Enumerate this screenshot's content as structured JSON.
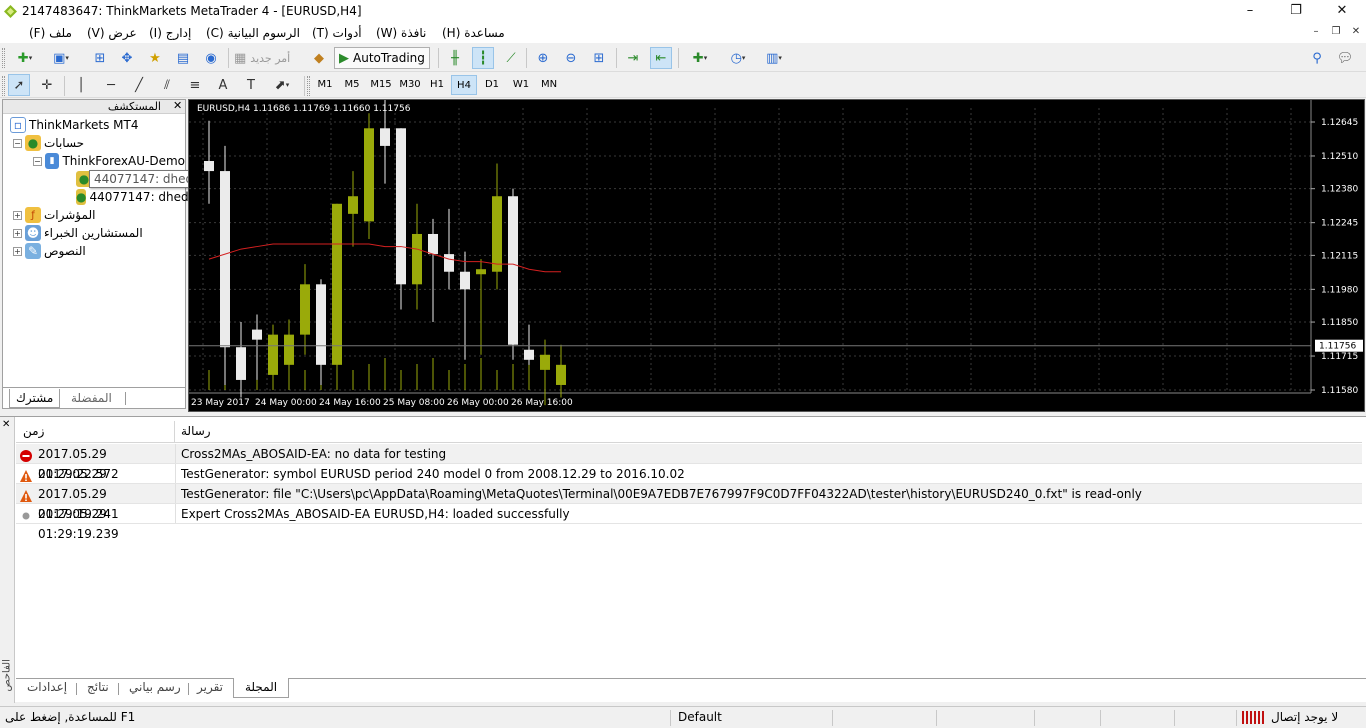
{
  "window": {
    "title": "2147483647: ThinkMarkets MetaTrader 4 - [EURUSD,H4]",
    "controls": [
      "–",
      "❐",
      "✕"
    ]
  },
  "menu": {
    "items": [
      "(F) ملف",
      "(V) عرض",
      "(I) إدارج",
      "(C) الرسوم البيانية",
      "(T) أدوات",
      "(W) نافذة",
      "(H) مساعدة"
    ]
  },
  "toolbar": {
    "new_order_label": "أمر جديد",
    "autotrading_label": "AutoTrading"
  },
  "timeframes": [
    "M1",
    "M5",
    "M15",
    "M30",
    "H1",
    "H4",
    "D1",
    "W1",
    "MN"
  ],
  "timeframe_active": "H4",
  "navigator": {
    "title": "المستكشف",
    "root": "ThinkMarkets MT4",
    "accounts": "حسابات",
    "server": "ThinkForexAU-Demo",
    "account1": "44077147: dhedhDFedhe",
    "account2": "44077147: dhedh",
    "indicators": "المؤشرات",
    "experts": "المستشارين الخبراء",
    "scripts": "النصوص",
    "tab_common": "مشترك",
    "tab_favorites": "المفضلة"
  },
  "chart_data": {
    "type": "candlestick",
    "symbol_info": "EURUSD,H4  1.11686 1.11769 1.11660 1.11756",
    "current_price": "1.11756",
    "y_ticks": [
      "1.12645",
      "1.12510",
      "1.12380",
      "1.12245",
      "1.12115",
      "1.11980",
      "1.11850",
      "1.11715",
      "1.11580"
    ],
    "y_tick_values": [
      1.12645,
      1.1251,
      1.1238,
      1.12245,
      1.12115,
      1.1198,
      1.1185,
      1.11715,
      1.1158
    ],
    "x_ticks": [
      "23 May 2017",
      "24 May 00:00",
      "24 May 16:00",
      "25 May 08:00",
      "26 May 00:00",
      "26 May 16:00"
    ],
    "candles": [
      {
        "o": 1.1249,
        "h": 1.1265,
        "l": 1.1232,
        "c": 1.1245
      },
      {
        "o": 1.1245,
        "h": 1.1255,
        "l": 1.116,
        "c": 1.1175
      },
      {
        "o": 1.1175,
        "h": 1.1185,
        "l": 1.1155,
        "c": 1.1162
      },
      {
        "o": 1.1182,
        "h": 1.1188,
        "l": 1.1162,
        "c": 1.1178
      },
      {
        "o": 1.1164,
        "h": 1.1184,
        "l": 1.1164,
        "c": 1.118
      },
      {
        "o": 1.1168,
        "h": 1.1186,
        "l": 1.1162,
        "c": 1.118
      },
      {
        "o": 1.118,
        "h": 1.1208,
        "l": 1.1172,
        "c": 1.12
      },
      {
        "o": 1.12,
        "h": 1.1202,
        "l": 1.116,
        "c": 1.1168
      },
      {
        "o": 1.1168,
        "h": 1.1232,
        "l": 1.1162,
        "c": 1.1232
      },
      {
        "o": 1.1228,
        "h": 1.1245,
        "l": 1.1215,
        "c": 1.1235
      },
      {
        "o": 1.1225,
        "h": 1.1268,
        "l": 1.1218,
        "c": 1.1262
      },
      {
        "o": 1.1262,
        "h": 1.1275,
        "l": 1.124,
        "c": 1.1255
      },
      {
        "o": 1.1262,
        "h": 1.1262,
        "l": 1.119,
        "c": 1.12
      },
      {
        "o": 1.12,
        "h": 1.1232,
        "l": 1.119,
        "c": 1.122
      },
      {
        "o": 1.122,
        "h": 1.1226,
        "l": 1.1185,
        "c": 1.1212
      },
      {
        "o": 1.1212,
        "h": 1.123,
        "l": 1.1198,
        "c": 1.1205
      },
      {
        "o": 1.1205,
        "h": 1.1213,
        "l": 1.117,
        "c": 1.1198
      },
      {
        "o": 1.1204,
        "h": 1.121,
        "l": 1.1172,
        "c": 1.1206
      },
      {
        "o": 1.1205,
        "h": 1.1248,
        "l": 1.1198,
        "c": 1.1235
      },
      {
        "o": 1.1235,
        "h": 1.1238,
        "l": 1.117,
        "c": 1.1176
      },
      {
        "o": 1.1174,
        "h": 1.1184,
        "l": 1.1168,
        "c": 1.117
      },
      {
        "o": 1.1166,
        "h": 1.1178,
        "l": 1.1152,
        "c": 1.1172
      },
      {
        "o": 1.116,
        "h": 1.1176,
        "l": 1.1155,
        "c": 1.1168
      }
    ],
    "ma": [
      1.121,
      1.1212,
      1.1214,
      1.1215,
      1.1216,
      1.1216,
      1.1216,
      1.1216,
      1.1216,
      1.1216,
      1.1216,
      1.1215,
      1.1215,
      1.1214,
      1.1212,
      1.121,
      1.1209,
      1.1209,
      1.1208,
      1.1208,
      1.1206,
      1.1205,
      1.1205
    ],
    "colors": {
      "bull": "#9aaa0a",
      "bear": "#ebebeb",
      "ma": "#d42020",
      "grid": "#3a3a3a",
      "axis": "#ffffff"
    }
  },
  "terminal": {
    "side_label": "الفاحص",
    "col_time": "زمن",
    "col_message": "رسالة",
    "rows": [
      {
        "icon": "error-icon",
        "time": "2017.05.29 01:29:22.572",
        "message": "Cross2MAs_ABOSAID-EA: no data for testing"
      },
      {
        "icon": "warning-icon",
        "time": "2017.05.29 01:29:19.241",
        "message": "TestGenerator: symbol EURUSD period 240 model 0 from 2008.12.29 to 2016.10.02"
      },
      {
        "icon": "warning-icon",
        "time": "2017.05.29 01:29:19.241",
        "message": "TestGenerator: file \"C:\\Users\\pc\\AppData\\Roaming\\MetaQuotes\\Terminal\\00E9A7EDB7E767997F9C0D7FF04322AD\\tester\\history\\EURUSD240_0.fxt\" is read-only"
      },
      {
        "icon": "info-icon",
        "time": "2017.05.29 01:29:19.239",
        "message": "Expert Cross2MAs_ABOSAID-EA EURUSD,H4: loaded successfully"
      }
    ],
    "tabs": [
      "إعدادات",
      "نتائج",
      "رسم بياني",
      "تقرير",
      "المجلة"
    ]
  },
  "status": {
    "help": "للمساعدة, إضغط على  F1",
    "profile": "Default",
    "connection": "لا يوجد إتصال"
  }
}
